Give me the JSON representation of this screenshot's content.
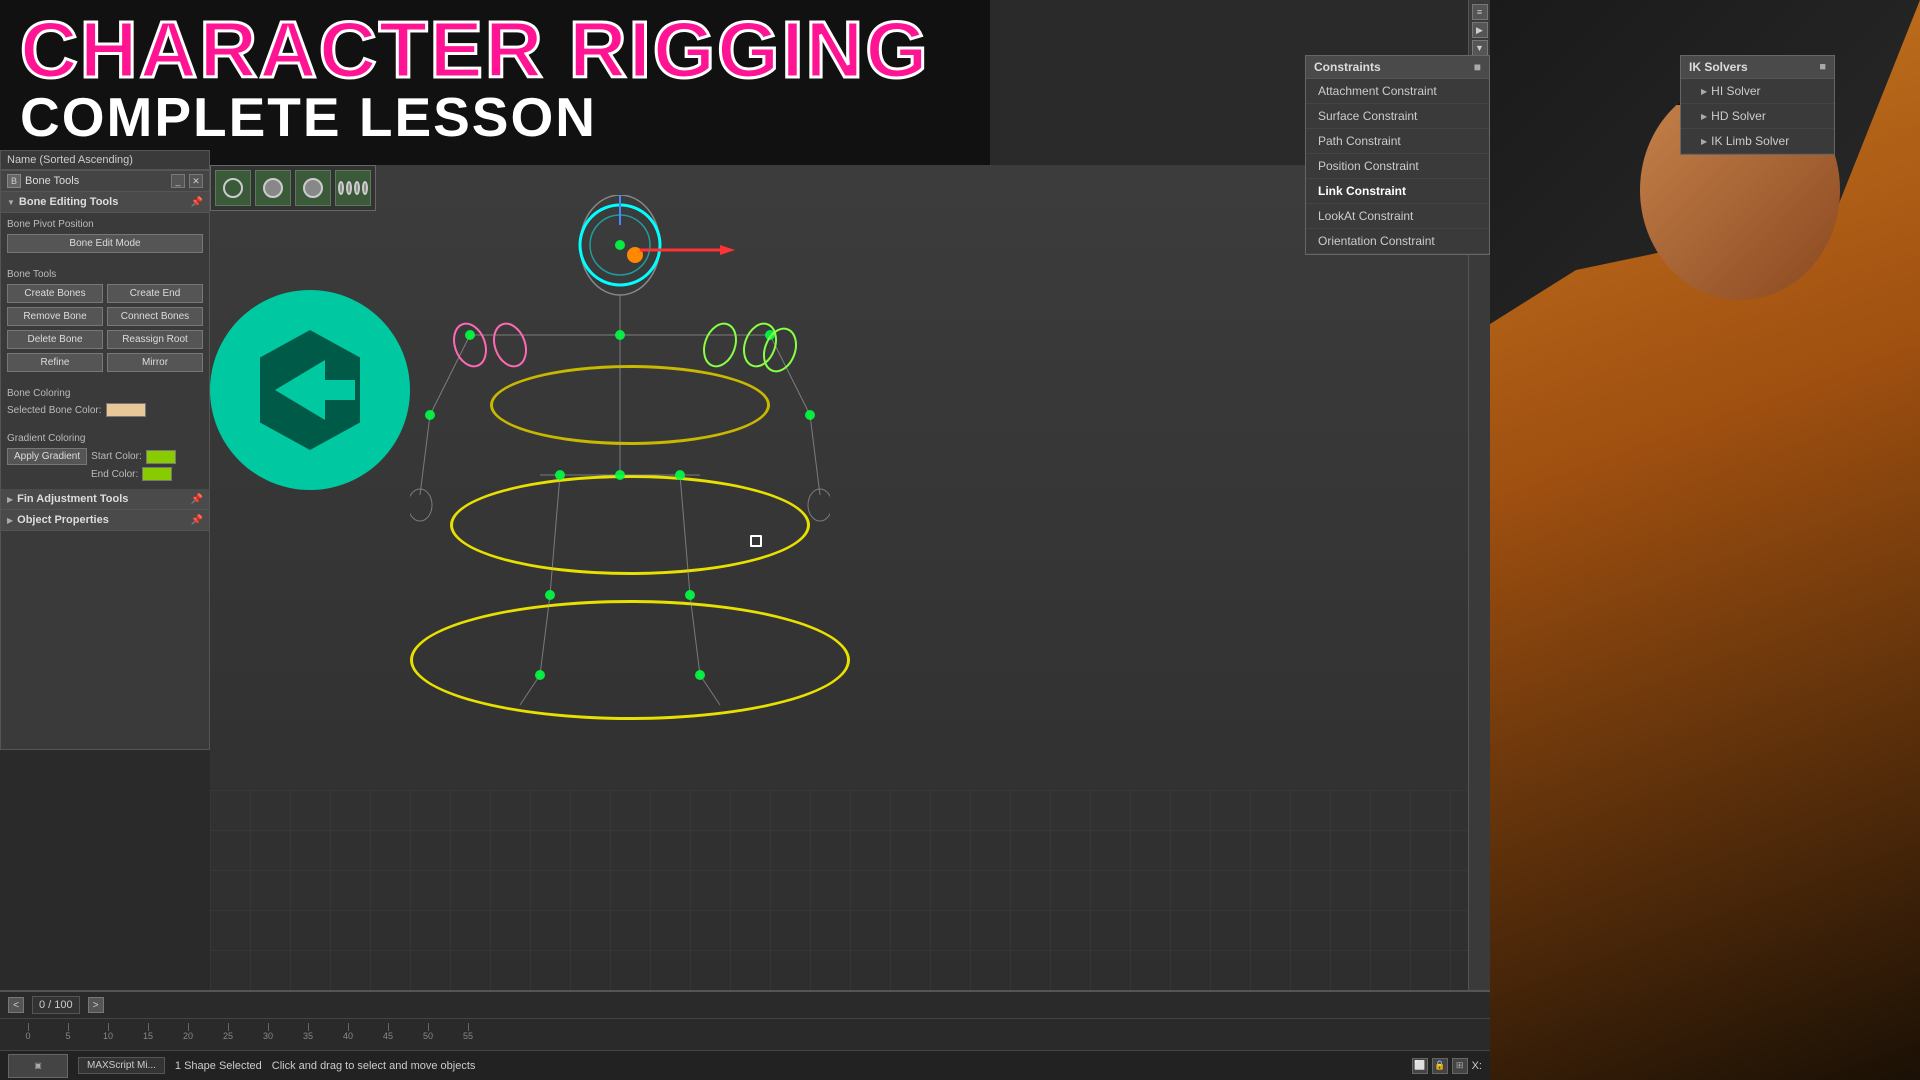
{
  "title": {
    "line1": "CHARACTER RIGGING",
    "line2": "COMPLETE LESSON"
  },
  "panel": {
    "title": "Bone Tools",
    "minimize_label": "_",
    "close_label": "✕"
  },
  "name_bar": {
    "label": "Name (Sorted Ascending)"
  },
  "bone_editing_tools": {
    "section_label": "Bone Editing Tools",
    "bone_pivot_position_label": "Bone Pivot Position",
    "bone_edit_mode_label": "Bone Edit Mode"
  },
  "bone_tools": {
    "section_label": "Bone Tools",
    "create_bones_label": "Create Bones",
    "create_end_label": "Create End",
    "remove_bone_label": "Remove Bone",
    "connect_bones_label": "Connect Bones",
    "delete_bone_label": "Delete Bone",
    "reassign_root_label": "Reassign Root",
    "refine_label": "Refine",
    "mirror_label": "Mirror"
  },
  "bone_coloring": {
    "section_label": "Bone Coloring",
    "selected_bone_color_label": "Selected Bone Color:",
    "selected_swatch_color": "#e8c898"
  },
  "gradient_coloring": {
    "section_label": "Gradient Coloring",
    "start_color_label": "Start Color:",
    "end_color_label": "End Color:",
    "apply_gradient_label": "Apply Gradient",
    "start_swatch_color": "#88cc00",
    "end_swatch_color": "#88cc00"
  },
  "fin_adjustment_tools": {
    "section_label": "Fin Adjustment Tools"
  },
  "object_properties": {
    "section_label": "Object Properties"
  },
  "constraints_panel": {
    "title": "Constraints",
    "close_label": "■",
    "items": [
      {
        "label": "Attachment Constraint",
        "highlighted": false
      },
      {
        "label": "Surface Constraint",
        "highlighted": false
      },
      {
        "label": "Path Constraint",
        "highlighted": false
      },
      {
        "label": "Position Constraint",
        "highlighted": false
      },
      {
        "label": "Link Constraint",
        "highlighted": true
      },
      {
        "label": "LookAt Constraint",
        "highlighted": false
      },
      {
        "label": "Orientation Constraint",
        "highlighted": false
      }
    ]
  },
  "ik_panel": {
    "title": "IK Solvers",
    "close_label": "■",
    "items": [
      {
        "label": "HI Solver"
      },
      {
        "label": "HD Solver"
      },
      {
        "label": "IK Limb Solver"
      }
    ]
  },
  "timeline": {
    "prev_label": "<",
    "next_label": ">",
    "counter": "0 / 100",
    "ruler_marks": [
      "0",
      "5",
      "10",
      "15",
      "20",
      "25",
      "30",
      "35",
      "40",
      "45",
      "50",
      "55"
    ]
  },
  "status": {
    "shape_selected": "1 Shape Selected",
    "hint": "Click and drag to select and move objects",
    "maxscript_label": "MAXScript Mi...",
    "coord_label": "X:"
  },
  "icons": {
    "panel_icon": "B",
    "section_arrow": "▼",
    "section_pin": "📌",
    "check_icon": "✓",
    "arrow_right": "▶"
  }
}
